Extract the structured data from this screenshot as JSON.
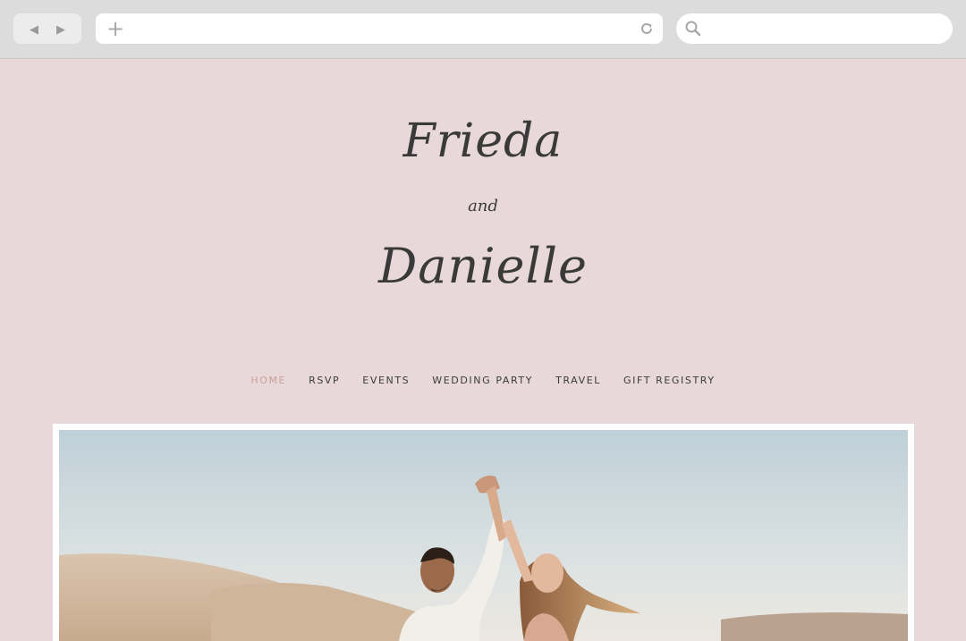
{
  "browser": {
    "back_icon": "◀",
    "forward_icon": "▶",
    "new_tab_icon": "+",
    "reload_icon": "reload-icon",
    "search_icon": "search-icon"
  },
  "couple": {
    "name1": "Frieda",
    "connector": "and",
    "name2": "Danielle"
  },
  "nav": {
    "items": [
      {
        "label": "HOME",
        "active": true
      },
      {
        "label": "RSVP"
      },
      {
        "label": "EVENTS"
      },
      {
        "label": "WEDDING PARTY"
      },
      {
        "label": "TRAVEL"
      },
      {
        "label": "GIFT REGISTRY"
      }
    ]
  },
  "colors": {
    "page_bg": "#e8d8d9",
    "active_nav": "#c9a09c",
    "text": "#3a3a3a"
  }
}
